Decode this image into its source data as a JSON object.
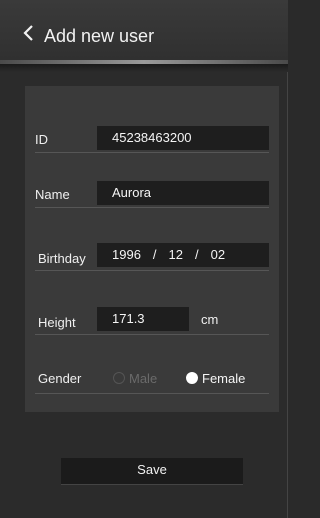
{
  "header": {
    "title": "Add new user"
  },
  "form": {
    "id": {
      "label": "ID",
      "value": "45238463200"
    },
    "name": {
      "label": "Name",
      "value": "Aurora"
    },
    "birthday": {
      "label": "Birthday",
      "year": "1996",
      "month": "12",
      "day": "02",
      "separator": "/"
    },
    "height": {
      "label": "Height",
      "value": "171.3",
      "unit": "cm"
    },
    "gender": {
      "label": "Gender",
      "options": [
        "Male",
        "Female"
      ],
      "selected": "Female"
    }
  },
  "actions": {
    "save_label": "Save"
  },
  "colors": {
    "background": "#2b2b2b",
    "panel": "#3a3a3a",
    "field": "#1e1e1e",
    "selected_radio": "#ffffff"
  }
}
